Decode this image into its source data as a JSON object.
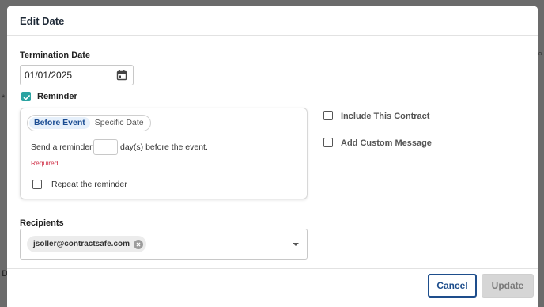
{
  "dialog": {
    "title": "Edit Date",
    "termination_label": "Termination Date",
    "termination_value": "01/01/2025",
    "reminder_label": "Reminder",
    "reminder_checked": true,
    "reminder_tabs": [
      {
        "label": "Before Event",
        "active": true
      },
      {
        "label": "Specific Date",
        "active": false
      }
    ],
    "send_prefix": "Send a reminder",
    "send_days_value": "",
    "send_suffix": "day(s) before the event.",
    "required_text": "Required",
    "repeat_label": "Repeat the reminder",
    "include_contract_label": "Include This Contract",
    "add_message_label": "Add Custom Message",
    "recipients_label": "Recipients",
    "recipients": [
      "jsoller@contractsafe.com"
    ],
    "cancel_label": "Cancel",
    "update_label": "Update"
  },
  "colors": {
    "accent_teal": "#2ba3a1",
    "primary_blue": "#1e4e8c",
    "error_red": "#d0334a",
    "disabled_gray": "#d6d6d6"
  },
  "icons": [
    "calendar-icon",
    "checkmark-icon",
    "close-circle-icon",
    "chevron-down-icon"
  ]
}
